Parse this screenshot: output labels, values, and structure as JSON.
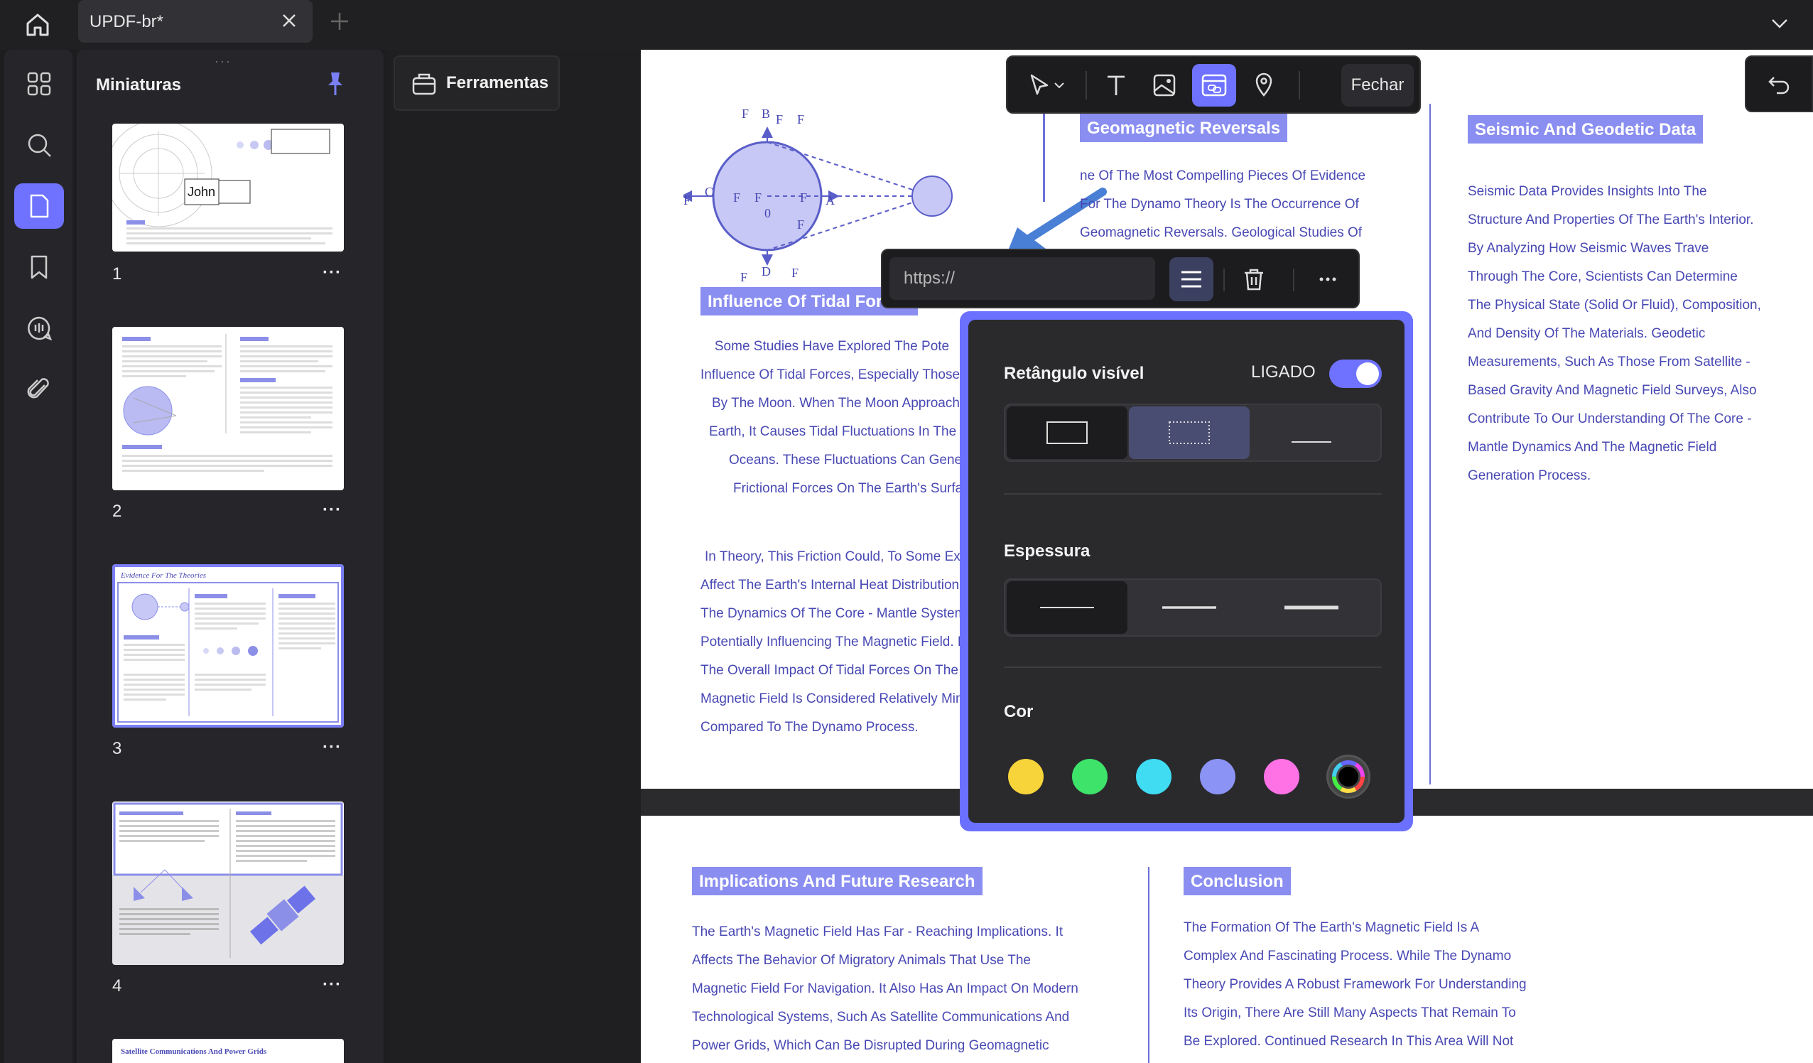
{
  "tab": {
    "title": "UPDF-br*"
  },
  "thumbnails": {
    "title": "Miniaturas",
    "pages": [
      {
        "number": "1",
        "more": "···",
        "stamp_name": "John"
      },
      {
        "number": "2",
        "more": "···"
      },
      {
        "number": "3",
        "more": "···",
        "header": "Evidence For The Theories"
      },
      {
        "number": "4",
        "more": "···"
      },
      {
        "number": "",
        "more": "",
        "header": "Satellite Communications And Power Grids"
      }
    ]
  },
  "tools": {
    "label": "Ferramentas"
  },
  "annotation_toolbar": {
    "close_label": "Fechar"
  },
  "link_bar": {
    "url_placeholder": "https://"
  },
  "props": {
    "visible_rect_label": "Retângulo visível",
    "visible_rect_state": "LIGADO",
    "thickness_label": "Espessura",
    "color_label": "Cor",
    "colors": [
      "#f7d43a",
      "#3ee36a",
      "#3fdcf2",
      "#8b93f5",
      "#ff72e6"
    ]
  },
  "document": {
    "diagram_labels": [
      "F",
      "B",
      "F",
      "F",
      "C",
      "F",
      "F",
      "F",
      "A",
      "F",
      "0",
      "F",
      "F",
      "D",
      "F"
    ],
    "geomagnetic": {
      "heading": "Geomagnetic Reversals",
      "lines": [
        "ne Of The Most Compelling Pieces Of Evidence",
        "For The Dynamo Theory Is The Occurrence Of",
        "Geomagnetic Reversals. Geological Studies Of"
      ]
    },
    "seismic": {
      "heading": "Seismic And Geodetic Data",
      "lines": [
        "Seismic Data Provides Insights Into The",
        "Structure And Properties Of The Earth's Interior.",
        "By Analyzing How Seismic Waves Trave",
        "Through The Core, Scientists Can Determine",
        "The Physical State (Solid Or Fluid), Composition,",
        "And Density Of The Materials. Geodetic",
        "Measurements, Such As Those From Satellite -",
        "Based Gravity And Magnetic Field Surveys, Also",
        "Contribute To Our Understanding Of The Core -",
        "Mantle Dynamics And The Magnetic Field",
        "Generation Process."
      ]
    },
    "tidal": {
      "heading": "Influence Of Tidal Forces",
      "lines_a": [
        "Some Studies Have Explored The Pote",
        "Influence Of Tidal Forces, Especially Those",
        "By The Moon. When The Moon Approache",
        "Earth, It Causes Tidal Fluctuations In The",
        "Oceans. These Fluctuations Can Gene",
        "Frictional Forces On The Earth's Surfa"
      ],
      "lines_b": [
        "In Theory, This Friction Could, To Some Ex",
        "Affect The Earth's Internal Heat Distribution",
        "The Dynamics Of The Core - Mantle System",
        "Potentially Influencing The Magnetic Field. H",
        "The Overall Impact Of Tidal Forces On The",
        "Magnetic Field Is Considered Relatively Min",
        "Compared To The Dynamo Process."
      ]
    },
    "implications": {
      "heading": "Implications And Future Research",
      "lines": [
        "The Earth's Magnetic Field Has Far - Reaching Implications. It",
        "Affects The Behavior Of Migratory Animals That Use The",
        "Magnetic Field For Navigation. It Also Has An Impact On Modern",
        "Technological Systems, Such As Satellite Communications And",
        "Power Grids, Which Can Be Disrupted During Geomagnetic"
      ]
    },
    "conclusion": {
      "heading": "Conclusion",
      "lines": [
        "The Formation Of The Earth's Magnetic Field Is A",
        "Complex And Fascinating Process. While The Dynamo",
        "Theory Provides A Robust Framework For Understanding",
        "Its Origin, There Are Still Many Aspects That Remain To",
        "Be Explored. Continued Research In This Area Will Not"
      ]
    }
  }
}
